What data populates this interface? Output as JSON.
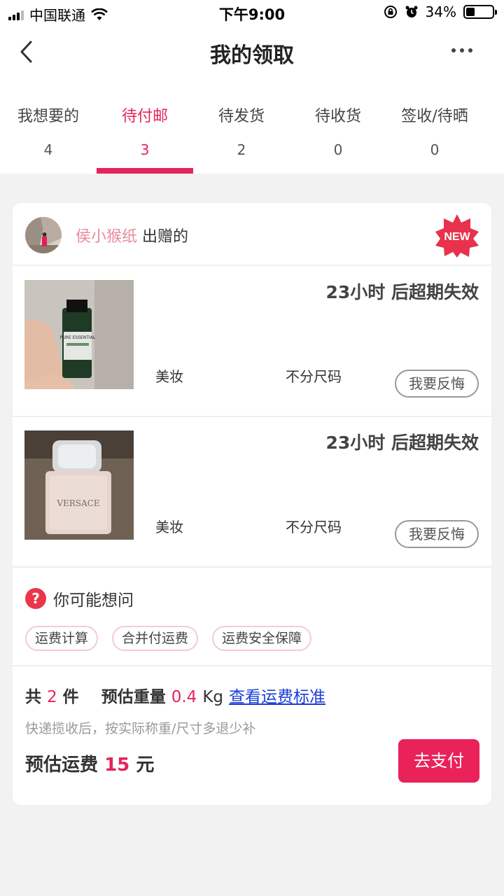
{
  "status_bar": {
    "carrier": "中国联通",
    "time": "下午9:00",
    "battery": "34%",
    "battery_level": 0.34,
    "icons": [
      "signal-icon",
      "wifi-icon",
      "rotation-lock-icon",
      "alarm-icon",
      "battery-icon"
    ]
  },
  "nav": {
    "title": "我的领取",
    "back_icon": "chevron-left-icon",
    "more_icon": "more-dots-icon"
  },
  "tabs": [
    {
      "label": "我想要的",
      "count": "4",
      "active": false
    },
    {
      "label": "待付邮",
      "count": "3",
      "active": true
    },
    {
      "label": "待发货",
      "count": "2",
      "active": false
    },
    {
      "label": "待收货",
      "count": "0",
      "active": false
    },
    {
      "label": "签收/待晒",
      "count": "0",
      "active": false
    }
  ],
  "order": {
    "giver_name": "侯小猴纸",
    "giver_suffix": "出赠的",
    "new_badge": "NEW",
    "items": [
      {
        "expire": "23小时 后超期失效",
        "category": "美妆",
        "size": "不分尺码",
        "action": "我要反悔",
        "image_label": "PURE ESSENTIAL"
      },
      {
        "expire": "23小时 后超期失效",
        "category": "美妆",
        "size": "不分尺码",
        "action": "我要反悔",
        "image_label": "VERSACE"
      }
    ],
    "faq": {
      "icon": "question-icon",
      "title": "你可能想问",
      "tags": [
        "运费计算",
        "合并付运费",
        "运费安全保障"
      ]
    },
    "summary": {
      "count_prefix": "共",
      "count": "2",
      "count_unit": "件",
      "weight_label": "预估重量",
      "weight_value": "0.4",
      "weight_unit": "Kg",
      "link": "查看运费标准",
      "note": "快递揽收后，按实际称重/尺寸多退少补",
      "fee_label": "预估运费",
      "fee_value": "15",
      "fee_unit": "元",
      "pay": "去支付"
    }
  },
  "colors": {
    "accent": "#e5245a",
    "pay_button": "#e9225a",
    "giver_name": "#e88a9c",
    "link": "#1a3cd6",
    "background": "#f2f2f2"
  }
}
